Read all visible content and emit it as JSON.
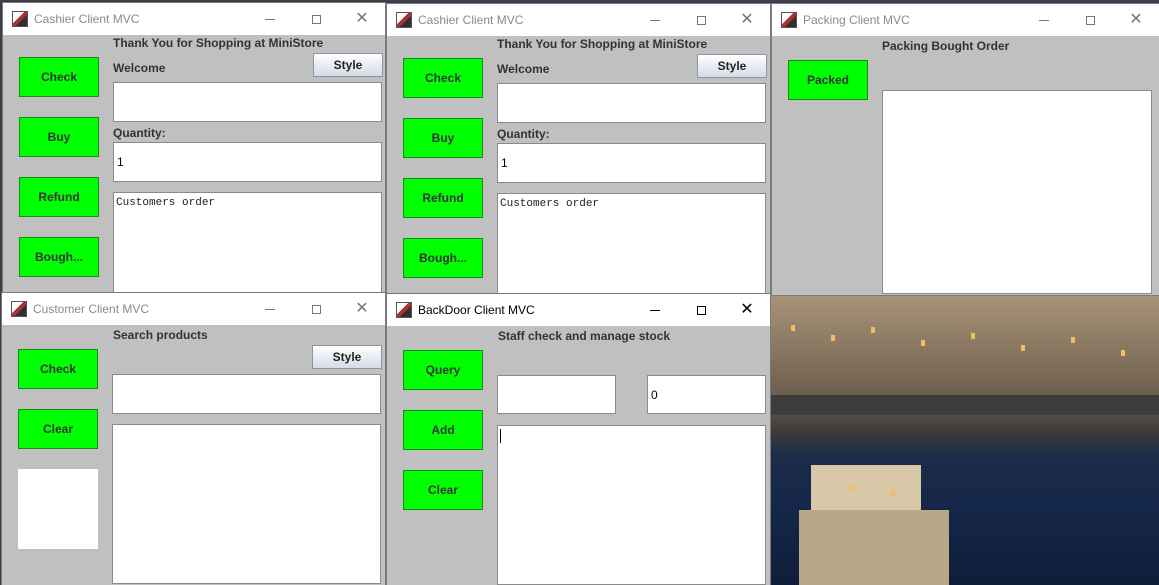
{
  "cashier1": {
    "title": "Cashier Client MVC",
    "header": "Thank You for Shopping at MiniStore",
    "welcome_label": "Welcome",
    "style_label": "Style",
    "quantity_label": "Quantity:",
    "quantity_value": "1",
    "order_text": "Customers order",
    "buttons": [
      "Check",
      "Buy",
      "Refund",
      "Bough..."
    ]
  },
  "cashier2": {
    "title": "Cashier Client MVC",
    "header": "Thank You for Shopping at MiniStore",
    "welcome_label": "Welcome",
    "style_label": "Style",
    "quantity_label": "Quantity:",
    "quantity_value": "1",
    "order_text": "Customers order",
    "buttons": [
      "Check",
      "Buy",
      "Refund",
      "Bough..."
    ]
  },
  "packing": {
    "title": "Packing Client MVC",
    "header": "Packing Bought Order",
    "packed_label": "Packed"
  },
  "customer": {
    "title": "Customer Client MVC",
    "header": "Search products",
    "style_label": "Style",
    "buttons": [
      "Check",
      "Clear"
    ]
  },
  "backdoor": {
    "title": "BackDoor Client MVC",
    "header": "Staff check and manage stock",
    "quantity_value": "0",
    "buttons": [
      "Query",
      "Add",
      "Clear"
    ]
  },
  "window_controls": {
    "minimize": "minimize-icon",
    "maximize": "maximize-icon",
    "close": "close-icon"
  },
  "colors": {
    "button_green": "#00ff00",
    "window_bg": "#c0c0c0",
    "titlebar_bg": "#ffffff"
  }
}
